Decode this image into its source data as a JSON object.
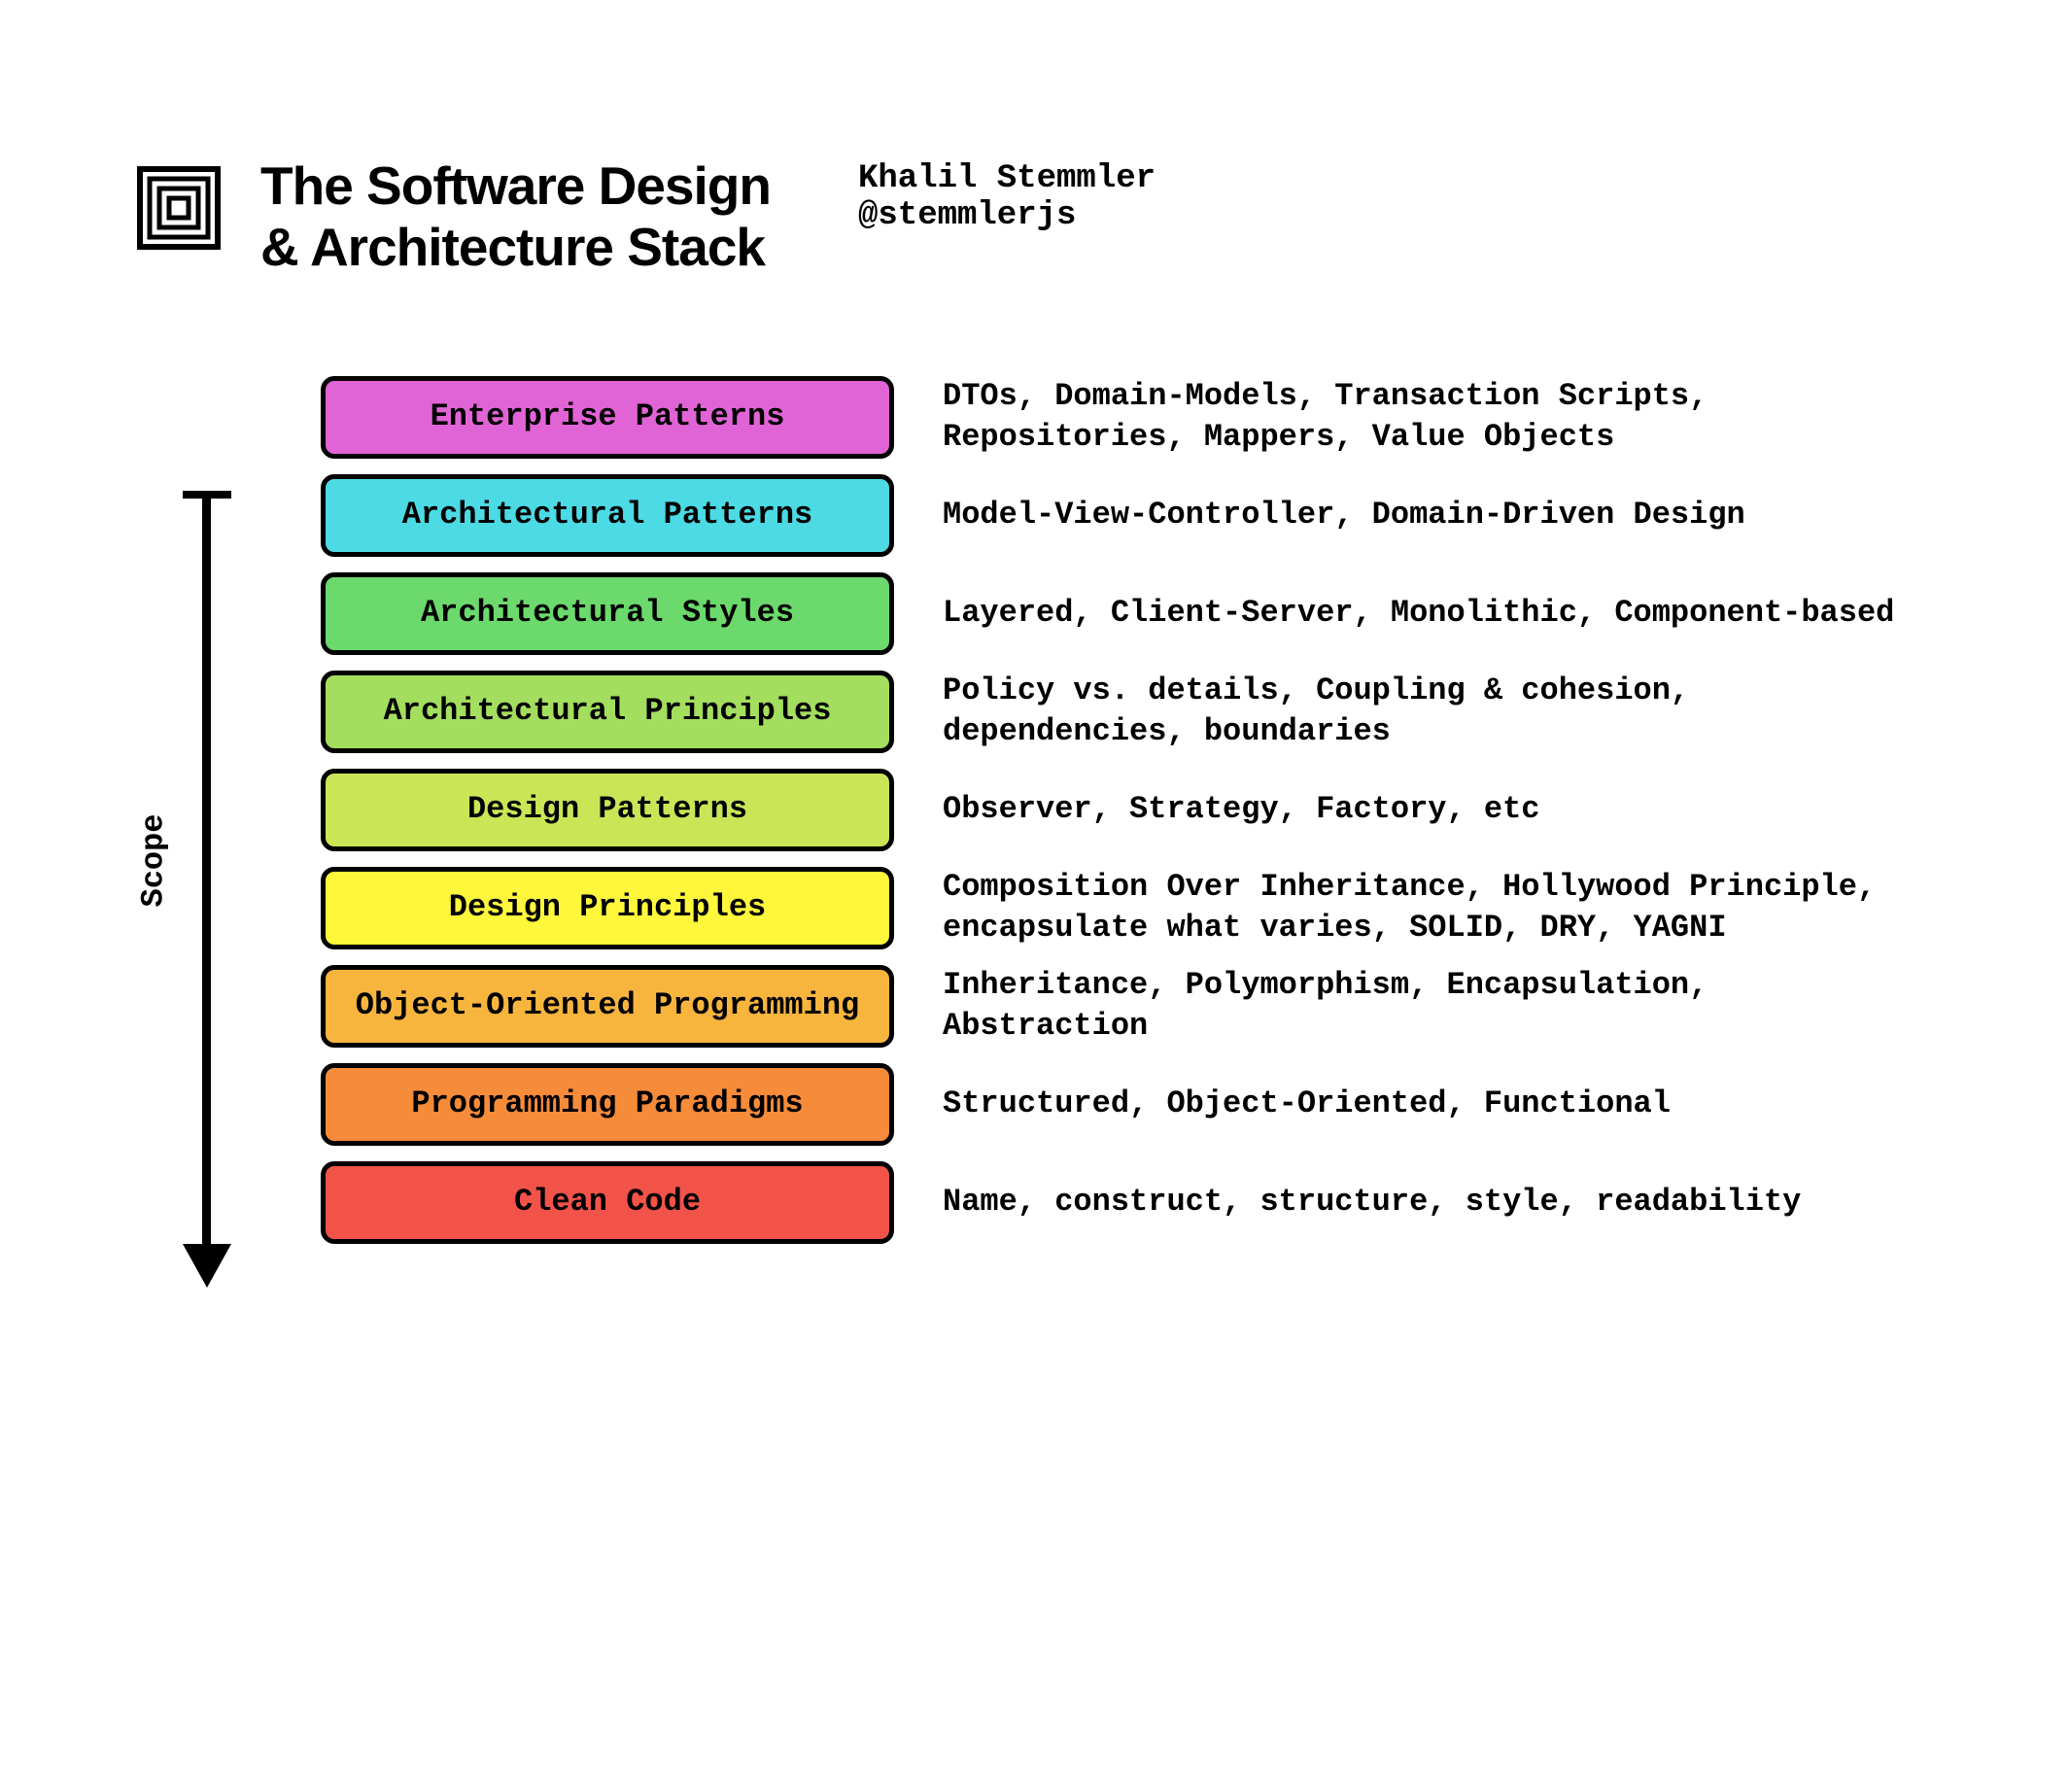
{
  "header": {
    "title_line1": "The Software Design",
    "title_line2": "& Architecture Stack",
    "author_name": "Khalil Stemmler",
    "author_handle": "@stemmlerjs"
  },
  "scope_label": "Scope",
  "layers": [
    {
      "label": "Enterprise Patterns",
      "desc": "DTOs, Domain-Models, Transaction Scripts, Repositories, Mappers, Value Objects",
      "color": "#e164d6"
    },
    {
      "label": "Architectural Patterns",
      "desc": "Model-View-Controller, Domain-Driven Design",
      "color": "#4cdae4"
    },
    {
      "label": "Architectural Styles",
      "desc": "Layered, Client-Server, Monolithic, Component-based",
      "color": "#6cd96c"
    },
    {
      "label": "Architectural Principles",
      "desc": "Policy vs. details, Coupling & cohesion, dependencies, boundaries",
      "color": "#a3de5e"
    },
    {
      "label": "Design Patterns",
      "desc": "Observer, Strategy, Factory, etc",
      "color": "#cae656"
    },
    {
      "label": "Design Principles",
      "desc": "Composition Over Inheritance, Hollywood Principle, encapsulate what varies, SOLID, DRY, YAGNI",
      "color": "#fff73c"
    },
    {
      "label": "Object-Oriented Programming",
      "desc": "Inheritance, Polymorphism, Encapsulation, Abstraction",
      "color": "#f8b53e"
    },
    {
      "label": "Programming Paradigms",
      "desc": "Structured, Object-Oriented, Functional",
      "color": "#f68b3a"
    },
    {
      "label": "Clean Code",
      "desc": "Name, construct, structure, style, readability",
      "color": "#f25349"
    }
  ]
}
